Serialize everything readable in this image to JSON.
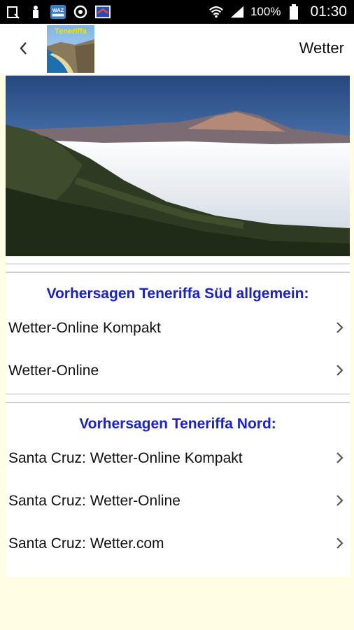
{
  "status_bar": {
    "battery_percent": "100%",
    "time": "01:30",
    "left_icons": [
      "screenshot-icon",
      "bookmark-icon",
      "news-app-icon",
      "sync-icon",
      "app-flag-icon"
    ],
    "news_badge": "WAZ"
  },
  "header": {
    "title": "Wetter",
    "logo_text": "Teneriffa"
  },
  "sections": [
    {
      "title": "Vorhersagen Teneriffa Süd allgemein:",
      "items": [
        {
          "label": "Wetter-Online Kompakt"
        },
        {
          "label": "Wetter-Online"
        }
      ]
    },
    {
      "title": "Vorhersagen Teneriffa Nord:",
      "items": [
        {
          "label": "Santa Cruz: Wetter-Online Kompakt"
        },
        {
          "label": "Santa Cruz: Wetter-Online"
        },
        {
          "label": "Santa Cruz: Wetter.com"
        }
      ]
    }
  ],
  "colors": {
    "section_title": "#1a22c8",
    "page_background": "#fffde4"
  }
}
